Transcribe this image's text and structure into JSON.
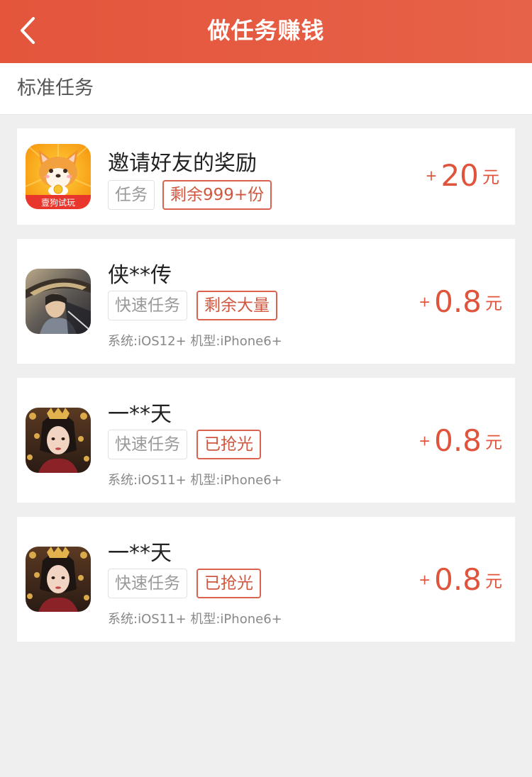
{
  "header": {
    "title": "做任务赚钱"
  },
  "section": {
    "title": "标准任务"
  },
  "tasks": [
    {
      "title": "邀请好友的奖励",
      "icon": "corgi-app-icon",
      "icon_label": "壹狗试玩",
      "tag_type": "任务",
      "tag_status": "剩余999+份",
      "requirements": "",
      "reward_plus": "+",
      "reward_amount": "20",
      "reward_unit": "元"
    },
    {
      "title": "侠**传",
      "icon": "swordsman-game-icon",
      "tag_type": "快速任务",
      "tag_status": "剩余大量",
      "requirements": "系统:iOS12+  机型:iPhone6+",
      "reward_plus": "+",
      "reward_amount": "0.8",
      "reward_unit": "元"
    },
    {
      "title": "一**天",
      "icon": "empress-game-icon",
      "tag_type": "快速任务",
      "tag_status": "已抢光",
      "requirements": "系统:iOS11+  机型:iPhone6+",
      "reward_plus": "+",
      "reward_amount": "0.8",
      "reward_unit": "元"
    },
    {
      "title": "一**天",
      "icon": "empress-game-icon",
      "tag_type": "快速任务",
      "tag_status": "已抢光",
      "requirements": "系统:iOS11+  机型:iPhone6+",
      "reward_plus": "+",
      "reward_amount": "0.8",
      "reward_unit": "元"
    }
  ],
  "colors": {
    "accent": "#e4553c",
    "tag_border": "#d9634e",
    "background": "#efefef"
  }
}
